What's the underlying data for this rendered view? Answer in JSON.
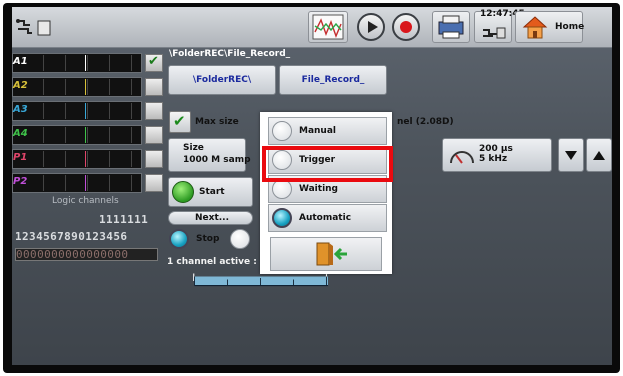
{
  "topbar": {
    "clock": "12:47:45",
    "home_label": "Home",
    "icons": [
      "usb-device-icon",
      "chart-icon",
      "play-icon",
      "record-icon",
      "printer-icon",
      "usb-icon",
      "home-icon"
    ]
  },
  "left": {
    "channels": [
      {
        "name": "A1",
        "color": "#ffffff",
        "checked": true
      },
      {
        "name": "A2",
        "color": "#d8c13a",
        "checked": false
      },
      {
        "name": "A3",
        "color": "#39a8d8",
        "checked": false
      },
      {
        "name": "A4",
        "color": "#3fc24a",
        "checked": false
      },
      {
        "name": "P1",
        "color": "#e0456a",
        "checked": false
      },
      {
        "name": "P2",
        "color": "#c04fd8",
        "checked": false
      }
    ],
    "logic_title": "Logic channels",
    "logic_row1": "1111111",
    "logic_row2": "1234567890123456",
    "logic_bar": "0000000000000000"
  },
  "panel": {
    "path": "\\FolderREC\\File_Record_",
    "folder_button": "\\FolderREC\\",
    "file_button": "File_Record_",
    "max_size_label": "Max size",
    "channel_text": "nel (2.08D)",
    "size_label": "Size",
    "size_value": "1000  M samp",
    "timebase_line1": "200 µs",
    "timebase_line2": "5 kHz",
    "start_label": "Start",
    "next_label": "Next...",
    "stop_label": "Stop",
    "active_text": "1 channel active :"
  },
  "dialog": {
    "options": [
      {
        "label": "Manual",
        "selected": false
      },
      {
        "label": "Trigger",
        "selected": false
      },
      {
        "label": "Waiting",
        "selected": false
      },
      {
        "label": "Automatic",
        "selected": true
      }
    ],
    "exit_icon": "exit-door-icon",
    "highlight_color": "#ea0a0f"
  }
}
